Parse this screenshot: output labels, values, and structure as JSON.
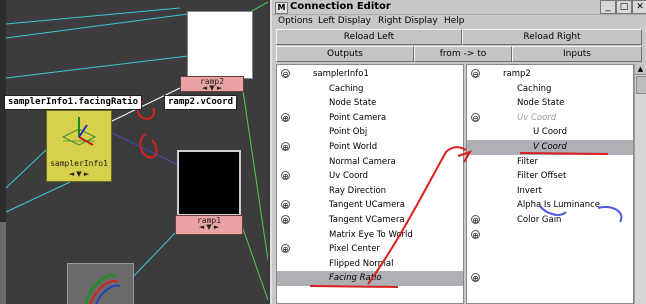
{
  "graph": {
    "nodes": {
      "sampler_label": "samplerInfo1",
      "ramp2_label": "ramp2",
      "ramp1_label": "ramp1",
      "arrows": "◄ ▼ ►"
    },
    "tags": {
      "source_attr": "samplerInfo1.facingRatio",
      "dest_attr": "ramp2.vCoord"
    }
  },
  "editor": {
    "title": "Connection Editor",
    "menu": [
      "Options",
      "Left Display",
      "Right Display",
      "Help"
    ],
    "window_buttons": [
      "_",
      "□",
      "✕"
    ],
    "reload_left": "Reload Left",
    "reload_right": "Reload Right",
    "outputs": "Outputs",
    "direction": "from -> to",
    "inputs": "Inputs",
    "left_list": [
      {
        "label": "samplerInfo1",
        "marker": "⊖",
        "indent": 1
      },
      {
        "label": "Caching",
        "marker": "",
        "indent": 2
      },
      {
        "label": "Node State",
        "marker": "",
        "indent": 2
      },
      {
        "label": "Point Camera",
        "marker": "⊕",
        "indent": 2
      },
      {
        "label": "Point Obj",
        "marker": "",
        "indent": 2
      },
      {
        "label": "Point World",
        "marker": "⊕",
        "indent": 2
      },
      {
        "label": "Normal Camera",
        "marker": "",
        "indent": 2
      },
      {
        "label": "Uv Coord",
        "marker": "⊕",
        "indent": 2
      },
      {
        "label": "Ray Direction",
        "marker": "",
        "indent": 2
      },
      {
        "label": "Tangent UCamera",
        "marker": "⊕",
        "indent": 2
      },
      {
        "label": "Tangent VCamera",
        "marker": "⊕",
        "indent": 2
      },
      {
        "label": "Matrix Eye To World",
        "marker": "",
        "indent": 2
      },
      {
        "label": "Pixel Center",
        "marker": "⊕",
        "indent": 2
      },
      {
        "label": "Flipped Normal",
        "marker": "",
        "indent": 2
      },
      {
        "label": "Facing Ratio",
        "marker": "",
        "indent": 2,
        "selected": true
      }
    ],
    "right_list": [
      {
        "label": "ramp2",
        "marker": "⊖",
        "indent": 1
      },
      {
        "label": "Caching",
        "marker": "",
        "indent": 2
      },
      {
        "label": "Node State",
        "marker": "",
        "indent": 2
      },
      {
        "label": "Uv Coord",
        "marker": "⊖",
        "indent": 2,
        "dim": true
      },
      {
        "label": "U Coord",
        "marker": "",
        "indent": 3
      },
      {
        "label": "V Coord",
        "marker": "",
        "indent": 3,
        "selected": true
      },
      {
        "label": "Filter",
        "marker": "",
        "indent": 2
      },
      {
        "label": "Filter Offset",
        "marker": "",
        "indent": 2
      },
      {
        "label": "Invert",
        "marker": "",
        "indent": 2
      },
      {
        "label": "Alpha Is Luminance",
        "marker": "",
        "indent": 2
      },
      {
        "label": "Color Gain",
        "marker": "⊕",
        "indent": 2
      },
      {
        "label": "",
        "marker": "⊕",
        "indent": 2
      },
      {
        "label": "",
        "marker": "",
        "indent": 2
      },
      {
        "label": "",
        "marker": "",
        "indent": 2
      },
      {
        "label": "",
        "marker": "⊕",
        "indent": 2
      }
    ]
  },
  "colors": {
    "node_yellow": "#d7d04a",
    "ramp_pink": "#e9a3a5",
    "selection": "#aeb0b6",
    "annotation_red": "#d8201e"
  }
}
